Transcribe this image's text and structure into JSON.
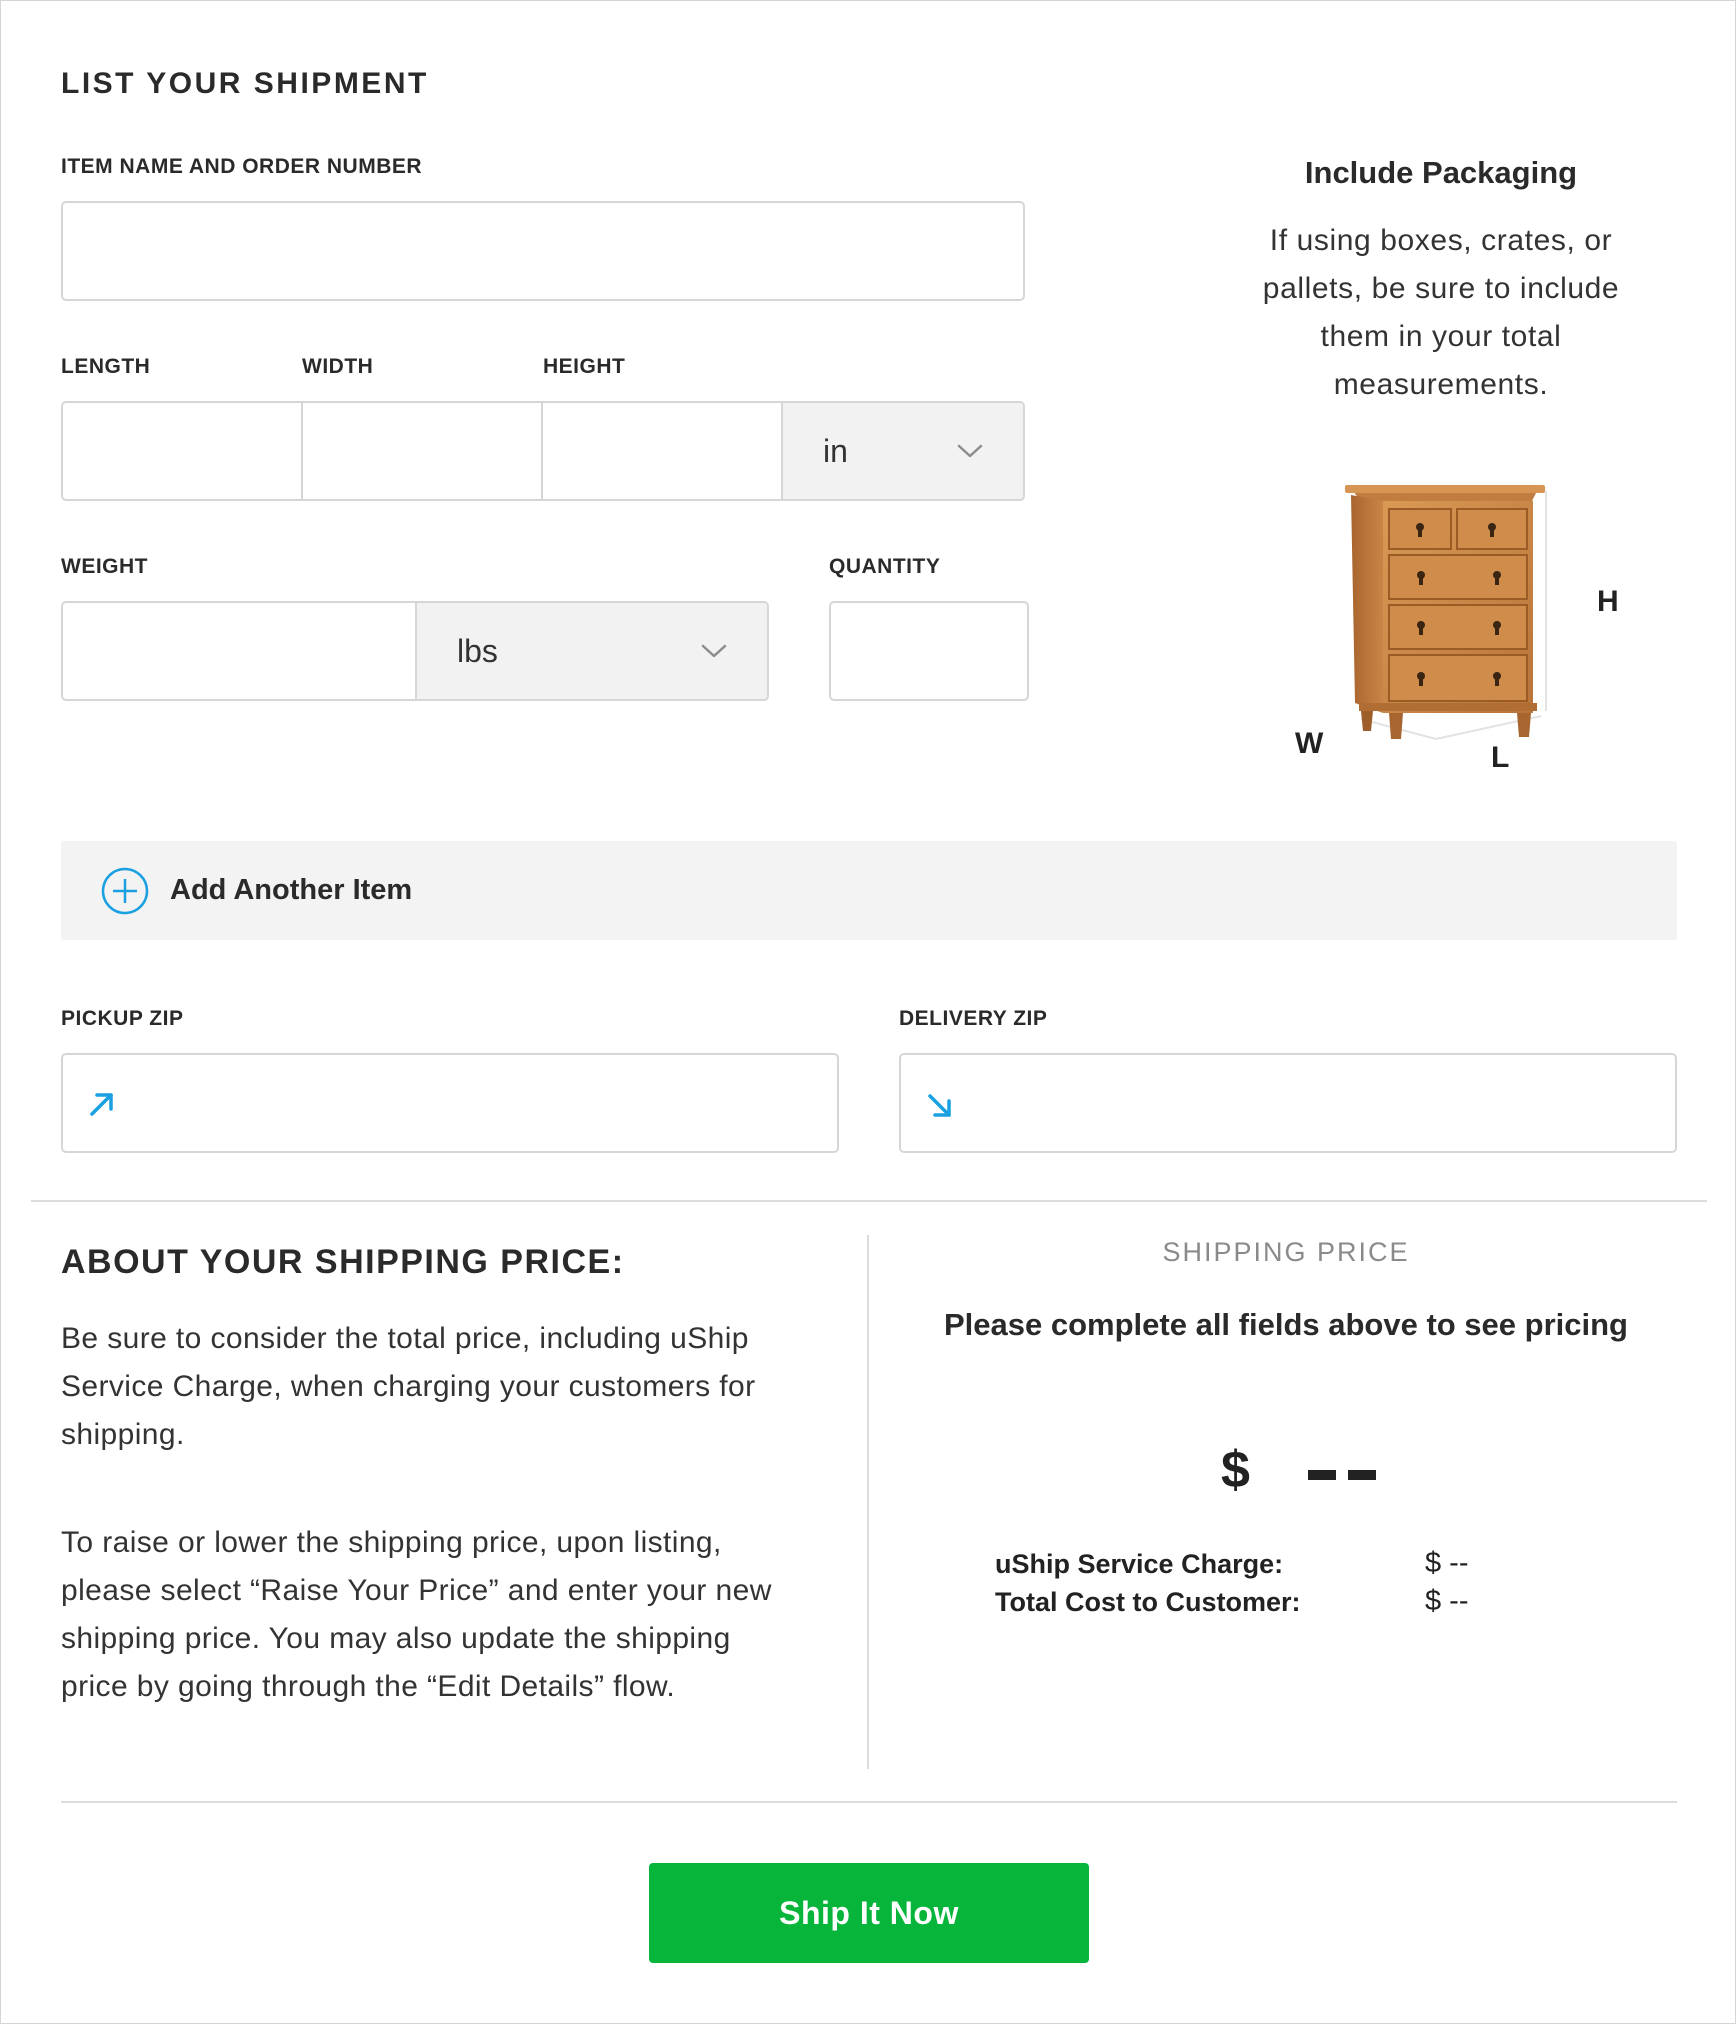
{
  "form": {
    "title": "LIST YOUR SHIPMENT",
    "item_name_label": "ITEM NAME AND ORDER NUMBER",
    "item_name_value": "",
    "length_label": "LENGTH",
    "width_label": "WIDTH",
    "height_label": "HEIGHT",
    "dimension_unit": "in",
    "weight_label": "WEIGHT",
    "weight_unit": "lbs",
    "quantity_label": "QUANTITY",
    "add_item_label": "Add Another Item",
    "pickup_zip_label": "PICKUP ZIP",
    "delivery_zip_label": "DELIVERY ZIP"
  },
  "packaging_tip": {
    "title": "Include Packaging",
    "lines": [
      "If using boxes, crates, or",
      "pallets, be sure to include",
      "them in your total",
      "measurements."
    ],
    "dim_labels": {
      "h": "H",
      "w": "W",
      "l": "L"
    }
  },
  "about": {
    "title": "ABOUT YOUR SHIPPING PRICE:",
    "para1": [
      "Be sure to consider the total price, including uShip",
      "Service Charge, when charging your customers for",
      "shipping."
    ],
    "para2": [
      "To raise or lower the shipping price, upon listing,",
      "please select “Raise Your Price” and enter your new",
      "shipping price. You may also update the shipping",
      "price by going through the “Edit Details” flow."
    ]
  },
  "pricing": {
    "label": "SHIPPING PRICE",
    "message": "Please complete all fields above to see pricing",
    "price_symbol": "$",
    "service_charge_label": "uShip Service Charge:",
    "service_charge_value": "$ --",
    "total_cost_label": "Total Cost to Customer:",
    "total_cost_value": "$ --"
  },
  "cta": {
    "label": "Ship It Now"
  },
  "colors": {
    "accent_blue": "#1a9fe0",
    "cta_green": "#07b53b"
  },
  "icons": {
    "add": "plus-circle-icon",
    "pickup": "arrow-up-right-icon",
    "delivery": "arrow-down-right-icon",
    "select": "chevron-down-icon"
  }
}
